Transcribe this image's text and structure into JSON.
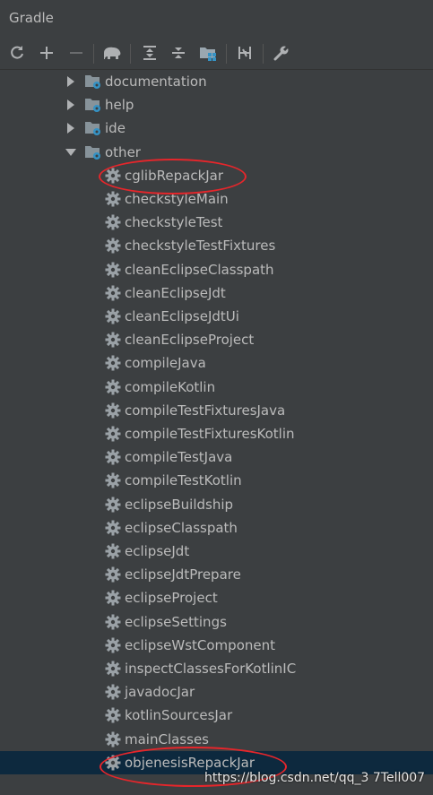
{
  "panel": {
    "title": "Gradle"
  },
  "toolbar": {
    "buttons": [
      "refresh-icon",
      "add-icon",
      "remove-icon",
      "elephant-icon",
      "expand-all-icon",
      "collapse-all-icon",
      "module-folder-icon",
      "toggle-offline-icon",
      "settings-wrench-icon"
    ]
  },
  "tree": {
    "groups": [
      {
        "label": "documentation",
        "expanded": false
      },
      {
        "label": "help",
        "expanded": false
      },
      {
        "label": "ide",
        "expanded": false
      },
      {
        "label": "other",
        "expanded": true
      }
    ],
    "tasks": [
      "cglibRepackJar",
      "checkstyleMain",
      "checkstyleTest",
      "checkstyleTestFixtures",
      "cleanEclipseClasspath",
      "cleanEclipseJdt",
      "cleanEclipseJdtUi",
      "cleanEclipseProject",
      "compileJava",
      "compileKotlin",
      "compileTestFixturesJava",
      "compileTestFixturesKotlin",
      "compileTestJava",
      "compileTestKotlin",
      "eclipseBuildship",
      "eclipseClasspath",
      "eclipseJdt",
      "eclipseJdtPrepare",
      "eclipseProject",
      "eclipseSettings",
      "eclipseWstComponent",
      "inspectClassesForKotlinIC",
      "javadocJar",
      "kotlinSourcesJar",
      "mainClasses",
      "objenesisRepackJar"
    ],
    "selected_task": "objenesisRepackJar"
  },
  "watermark": "https://blog.csdn.net/qq_3 7Tell007",
  "colors": {
    "background": "#3c3f41",
    "text": "#bbbbbb",
    "selection": "#0d293e",
    "annotation": "#e6262b"
  }
}
